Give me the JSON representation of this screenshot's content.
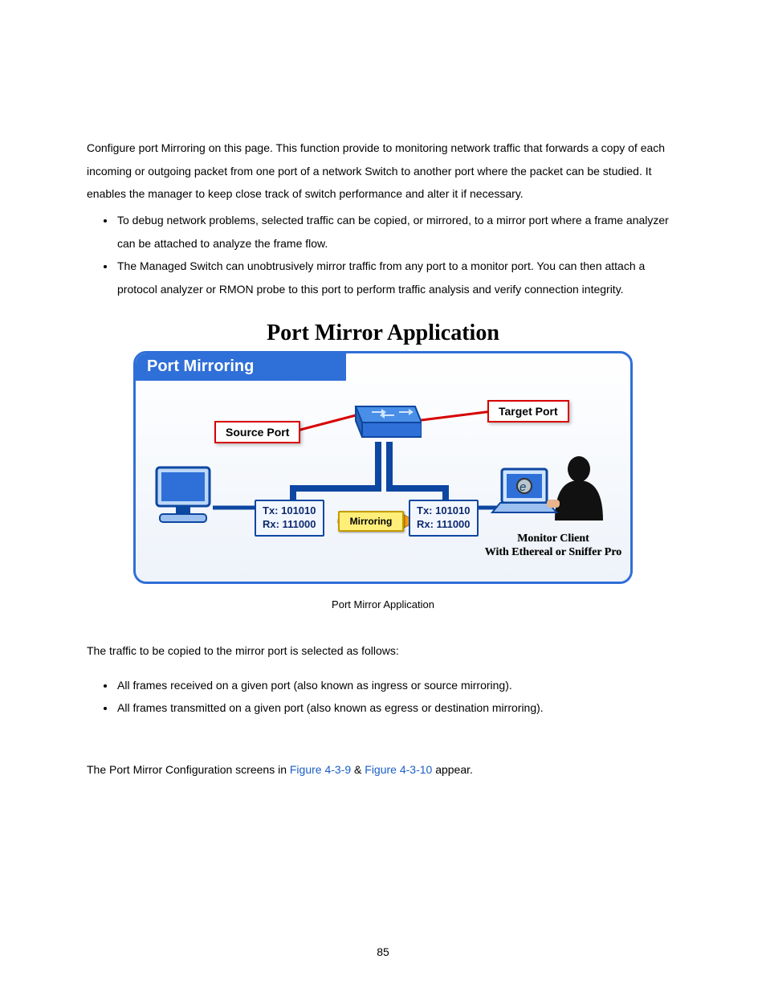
{
  "intro_paragraph": "Configure port Mirroring on this page. This function provide to monitoring network traffic that forwards a copy of each incoming or outgoing packet from one port of a network Switch to another port where the packet can be studied. It enables the manager to keep close track of switch performance and alter it if necessary.",
  "bullets1": [
    "To debug network problems, selected traffic can be copied, or mirrored, to a mirror port where a frame analyzer can be attached to analyze the frame flow.",
    "The Managed Switch can unobtrusively mirror traffic from any port to a monitor port. You can then attach a protocol analyzer or RMON probe to this port to perform traffic analysis and verify connection integrity."
  ],
  "diagram": {
    "title": "Port Mirror Application",
    "banner": "Port Mirroring",
    "source_label": "Source Port",
    "target_label": "Target Port",
    "tx": "Tx: 101010",
    "rx": "Rx: 111000",
    "mirror_label": "Mirroring",
    "monitor_line1": "Monitor Client",
    "monitor_line2": "With Ethereal or Sniffer Pro"
  },
  "caption": "Port Mirror Application",
  "para_after_diagram": "The traffic to be copied to the mirror port is selected as follows:",
  "bullets2": [
    "All frames received on a given port (also known as ingress or source mirroring).",
    "All frames transmitted on a given port (also known as egress or destination mirroring)."
  ],
  "config_sentence": {
    "pre": "The Port Mirror Configuration screens in ",
    "link1": "Figure 4-3-9",
    "mid": " & ",
    "link2": "Figure 4-3-10",
    "post": " appear."
  },
  "page_number": "85"
}
